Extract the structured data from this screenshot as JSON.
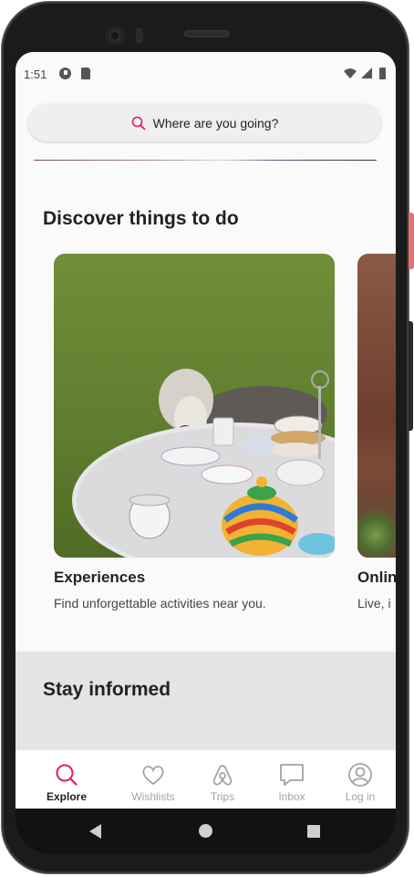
{
  "status_bar": {
    "time": "1:51"
  },
  "search": {
    "placeholder": "Where are you going?"
  },
  "discover": {
    "title": "Discover things to do",
    "cards": [
      {
        "title": "Experiences",
        "subtitle": "Find unforgettable activities near you."
      },
      {
        "title": "Onlin",
        "subtitle": "Live, i"
      }
    ]
  },
  "stay_informed": {
    "title": "Stay informed"
  },
  "tabs": [
    {
      "label": "Explore",
      "icon": "search-icon",
      "active": true
    },
    {
      "label": "Wishlists",
      "icon": "heart-icon",
      "active": false
    },
    {
      "label": "Trips",
      "icon": "airbnb-logo-icon",
      "active": false
    },
    {
      "label": "Inbox",
      "icon": "chat-icon",
      "active": false
    },
    {
      "label": "Log in",
      "icon": "user-circle-icon",
      "active": false
    }
  ],
  "colors": {
    "accent": "#e31c5f",
    "text": "#222222",
    "muted": "#a3a3a3",
    "search_bg": "#efeff1"
  }
}
